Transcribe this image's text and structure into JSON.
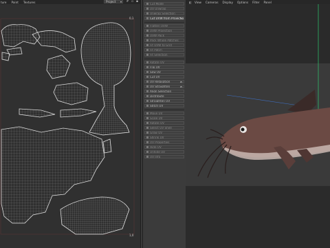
{
  "uv_editor": {
    "menu": [
      "ture",
      "Paint",
      "Textures"
    ],
    "dropdown_value": "Project",
    "corner_top_right": "0,1",
    "corner_bottom_right": "1,0"
  },
  "sidebar": {
    "items": [
      {
        "label": "Cut Mode",
        "state": "dim"
      },
      {
        "label": "UV Unwrap",
        "state": "dim"
      },
      {
        "label": "Unwrap Selection",
        "state": "dim"
      },
      {
        "label": "Cut UVW from Projection",
        "state": "bright",
        "gear": true
      },
      {
        "label": "Flatten UVW",
        "state": "dim"
      },
      {
        "label": "UVW Projection",
        "state": "dim"
      },
      {
        "label": "UVW Pack",
        "state": "dim"
      },
      {
        "label": "Pack Whole Patches",
        "state": "dim"
      },
      {
        "label": "Fit UVW to Grid",
        "state": "dim"
      },
      {
        "label": "Fit Patch",
        "state": "dim"
      },
      {
        "label": "Fit Selection",
        "state": "dim"
      },
      {
        "label": "Rotate UV",
        "state": "dim"
      },
      {
        "label": "Flip UV",
        "state": "normal"
      },
      {
        "label": "Sew UV",
        "state": "normal"
      },
      {
        "label": "Cut UV",
        "state": "normal"
      },
      {
        "label": "UV Relaxation",
        "state": "normal",
        "gear": true
      },
      {
        "label": "UV Straighten",
        "state": "normal",
        "gear": true
      },
      {
        "label": "Align Selection",
        "state": "normal"
      },
      {
        "label": "Distribute",
        "state": "normal"
      },
      {
        "label": "Straighten UV",
        "state": "normal"
      },
      {
        "label": "Stitch UV",
        "state": "normal"
      },
      {
        "label": "Move UV",
        "state": "dim"
      },
      {
        "label": "Scale UV",
        "state": "dim"
      },
      {
        "label": "Rotate UV",
        "state": "dim"
      },
      {
        "label": "Select UV Shell",
        "state": "dim"
      },
      {
        "label": "Grow UV",
        "state": "dim"
      },
      {
        "label": "Shrink UV",
        "state": "dim"
      },
      {
        "label": "UV Properties",
        "state": "dim"
      },
      {
        "label": "Hide UV",
        "state": "dim"
      },
      {
        "label": "Unhide UV",
        "state": "dim"
      },
      {
        "label": "UV Info",
        "state": "dim"
      }
    ]
  },
  "viewport": {
    "menu": [
      "View",
      "Cameras",
      "Display",
      "Options",
      "Filter",
      "Panel"
    ]
  },
  "colors": {
    "uv_line": "#d8d8d8",
    "grid_axis_green": "#2ecc71",
    "grid_axis_blue": "#4a7dd8",
    "uv_frame": "#b84a4a"
  }
}
